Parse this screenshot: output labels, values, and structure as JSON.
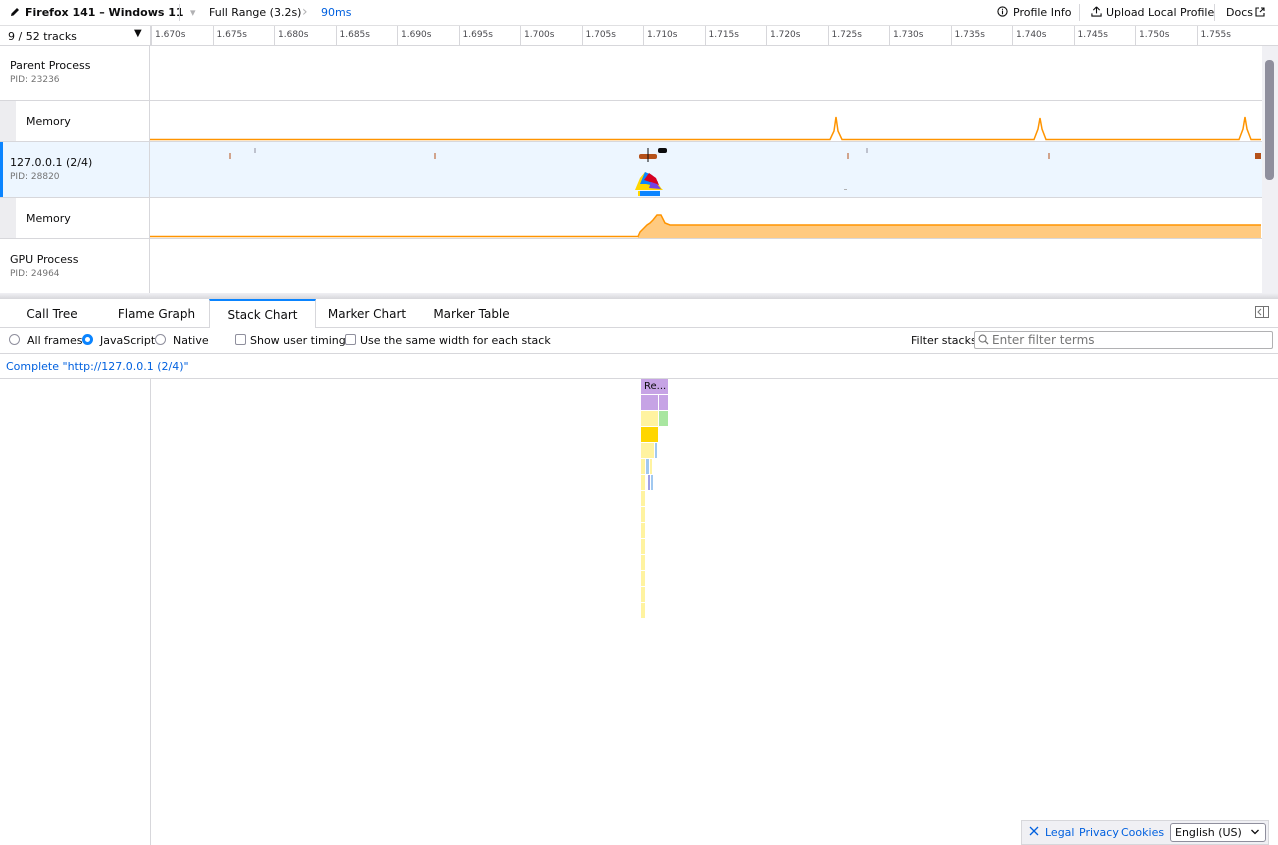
{
  "topbar": {
    "title": "Firefox 141 – Windows 11",
    "full_range": "Full Range (3.2s)",
    "zoom_range": "90ms",
    "profile_info": "Profile Info",
    "upload": "Upload Local Profile",
    "docs": "Docs"
  },
  "tracks": {
    "count": "9 / 52 tracks",
    "ticks": [
      "1.670s",
      "1.675s",
      "1.680s",
      "1.685s",
      "1.690s",
      "1.695s",
      "1.700s",
      "1.705s",
      "1.710s",
      "1.715s",
      "1.720s",
      "1.725s",
      "1.730s",
      "1.735s",
      "1.740s",
      "1.745s",
      "1.750s",
      "1.755s"
    ],
    "parent": {
      "name": "Parent Process",
      "pid": "PID: 23236"
    },
    "memory1": {
      "name": "Memory"
    },
    "content": {
      "name": "127.0.0.1 (2/4)",
      "pid": "PID: 28820"
    },
    "memory2": {
      "name": "Memory"
    },
    "gpu": {
      "name": "GPU Process",
      "pid": "PID: 24964"
    }
  },
  "tabs": [
    "Call Tree",
    "Flame Graph",
    "Stack Chart",
    "Marker Chart",
    "Marker Table"
  ],
  "settings": {
    "all_frames": "All frames",
    "javascript": "JavaScript",
    "native": "Native",
    "show_user_timing": "Show user timing",
    "same_width": "Use the same width for each stack",
    "filter_label": "Filter stacks:",
    "filter_placeholder": "Enter filter terms"
  },
  "breadcrumb": "Complete \"http://127.0.0.1 (2/4)\"",
  "stack": {
    "top_label": "Re..."
  },
  "footer": {
    "legal": "Legal",
    "privacy": "Privacy",
    "cookies": "Cookies",
    "language": "English (US)"
  },
  "colors": {
    "accent": "#0a84ff",
    "memory": "#ff9400",
    "memory_fill": "#ffca80",
    "selected_row": "#edf6ff"
  }
}
